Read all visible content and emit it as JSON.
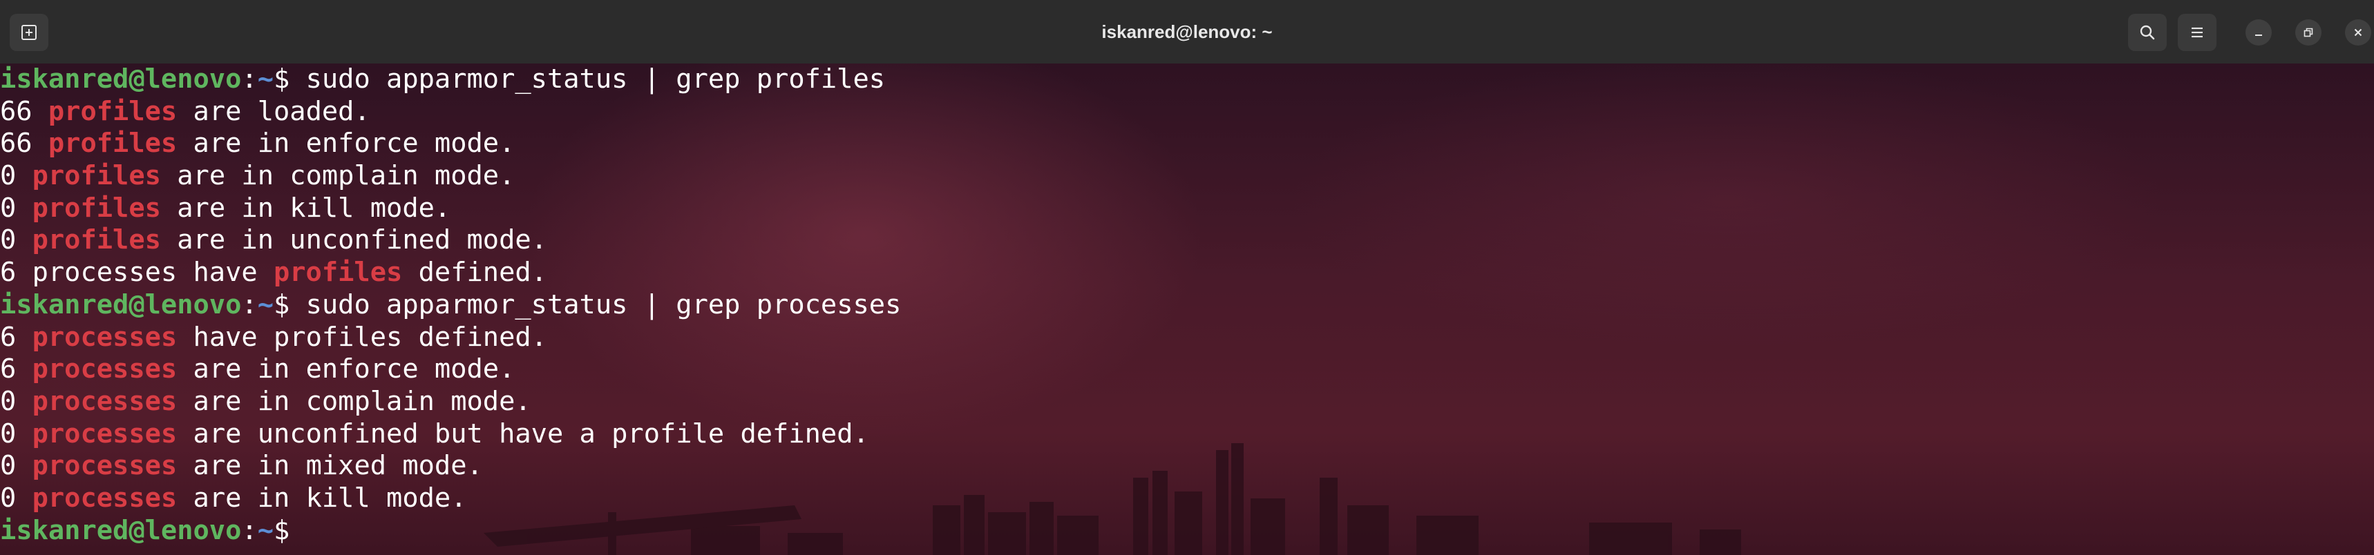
{
  "window": {
    "title": "iskanred@lenovo: ~",
    "accent_color": "#d93d45",
    "prompt_color": "#5fb65f",
    "path_color": "#5c8fd6"
  },
  "titlebar": {
    "new_tab_icon": "new-tab-icon",
    "search_icon": "search-icon",
    "menu_icon": "hamburger-menu-icon",
    "minimize_icon": "minimize-icon",
    "restore_icon": "restore-icon",
    "close_icon": "close-icon"
  },
  "prompt": {
    "user_host": "iskanred@lenovo",
    "colon": ":",
    "path": "~",
    "symbol": "$"
  },
  "lines": [
    {
      "type": "command",
      "text": " sudo apparmor_status | grep profiles"
    },
    {
      "type": "output",
      "parts": [
        {
          "t": "66 "
        },
        {
          "t": "profiles",
          "hl": true
        },
        {
          "t": " are loaded."
        }
      ]
    },
    {
      "type": "output",
      "parts": [
        {
          "t": "66 "
        },
        {
          "t": "profiles",
          "hl": true
        },
        {
          "t": " are in enforce mode."
        }
      ]
    },
    {
      "type": "output",
      "parts": [
        {
          "t": "0 "
        },
        {
          "t": "profiles",
          "hl": true
        },
        {
          "t": " are in complain mode."
        }
      ]
    },
    {
      "type": "output",
      "parts": [
        {
          "t": "0 "
        },
        {
          "t": "profiles",
          "hl": true
        },
        {
          "t": " are in kill mode."
        }
      ]
    },
    {
      "type": "output",
      "parts": [
        {
          "t": "0 "
        },
        {
          "t": "profiles",
          "hl": true
        },
        {
          "t": " are in unconfined mode."
        }
      ]
    },
    {
      "type": "output",
      "parts": [
        {
          "t": "6 processes have "
        },
        {
          "t": "profiles",
          "hl": true
        },
        {
          "t": " defined."
        }
      ]
    },
    {
      "type": "command",
      "text": " sudo apparmor_status | grep processes"
    },
    {
      "type": "output",
      "parts": [
        {
          "t": "6 "
        },
        {
          "t": "processes",
          "hl": true
        },
        {
          "t": " have profiles defined."
        }
      ]
    },
    {
      "type": "output",
      "parts": [
        {
          "t": "6 "
        },
        {
          "t": "processes",
          "hl": true
        },
        {
          "t": " are in enforce mode."
        }
      ]
    },
    {
      "type": "output",
      "parts": [
        {
          "t": "0 "
        },
        {
          "t": "processes",
          "hl": true
        },
        {
          "t": " are in complain mode."
        }
      ]
    },
    {
      "type": "output",
      "parts": [
        {
          "t": "0 "
        },
        {
          "t": "processes",
          "hl": true
        },
        {
          "t": " are unconfined but have a profile defined."
        }
      ]
    },
    {
      "type": "output",
      "parts": [
        {
          "t": "0 "
        },
        {
          "t": "processes",
          "hl": true
        },
        {
          "t": " are in mixed mode."
        }
      ]
    },
    {
      "type": "output",
      "parts": [
        {
          "t": "0 "
        },
        {
          "t": "processes",
          "hl": true
        },
        {
          "t": " are in kill mode."
        }
      ]
    },
    {
      "type": "command",
      "text": ""
    }
  ]
}
